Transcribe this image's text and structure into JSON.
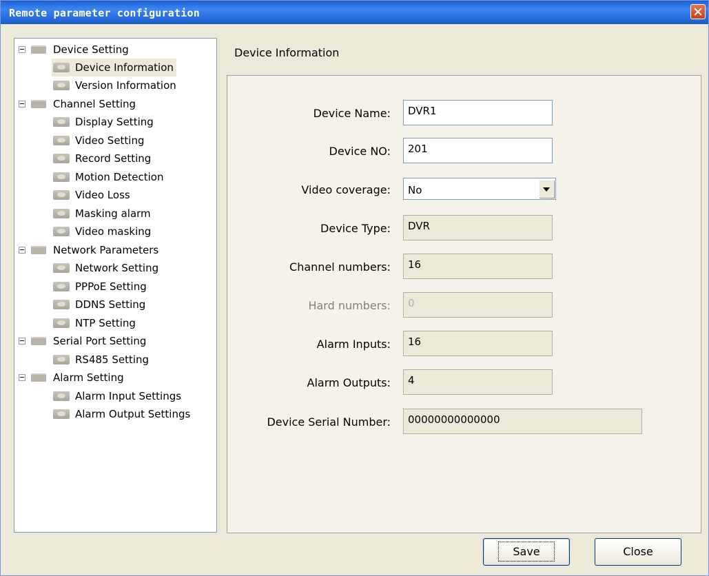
{
  "window": {
    "title": "Remote parameter configuration"
  },
  "tree": {
    "groups": [
      {
        "label": "Device Setting",
        "children": [
          "Device Information",
          "Version Information"
        ]
      },
      {
        "label": "Channel Setting",
        "children": [
          "Display Setting",
          "Video Setting",
          "Record Setting",
          "Motion Detection",
          "Video Loss",
          "Masking alarm",
          "Video masking"
        ]
      },
      {
        "label": "Network Parameters",
        "children": [
          "Network Setting",
          "PPPoE Setting",
          "DDNS Setting",
          "NTP Setting"
        ]
      },
      {
        "label": "Serial Port Setting",
        "children": [
          "RS485 Setting"
        ]
      },
      {
        "label": "Alarm Setting",
        "children": [
          "Alarm Input Settings",
          "Alarm Output Settings"
        ]
      }
    ],
    "selected": "Device Information"
  },
  "main": {
    "section_title": "Device Information",
    "fields": {
      "device_name": {
        "label": "Device Name:",
        "value": "DVR1"
      },
      "device_no": {
        "label": "Device NO:",
        "value": "201"
      },
      "video_coverage": {
        "label": "Video coverage:",
        "value": "No"
      },
      "device_type": {
        "label": "Device Type:",
        "value": "DVR"
      },
      "channel_numbers": {
        "label": "Channel numbers:",
        "value": "16"
      },
      "hard_numbers": {
        "label": "Hard numbers:",
        "value": "0"
      },
      "alarm_inputs": {
        "label": "Alarm Inputs:",
        "value": "16"
      },
      "alarm_outputs": {
        "label": "Alarm Outputs:",
        "value": "4"
      },
      "serial_number": {
        "label": "Device Serial Number:",
        "value": "00000000000000"
      }
    }
  },
  "buttons": {
    "save": "Save",
    "close": "Close"
  }
}
